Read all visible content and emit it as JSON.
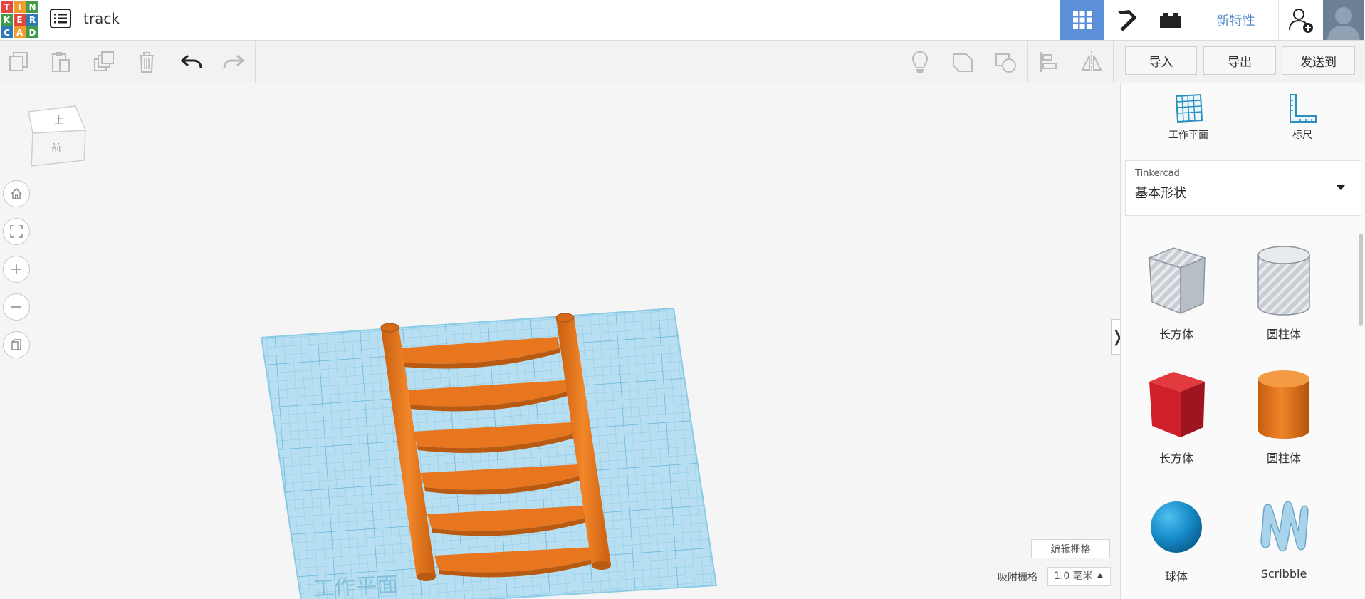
{
  "app": {
    "logo_letters": [
      "T",
      "I",
      "N",
      "K",
      "E",
      "R",
      "C",
      "A",
      "D"
    ],
    "logo_colors": [
      "#e2463c",
      "#f29a2e",
      "#3f9a49",
      "#3f9a49",
      "#e2463c",
      "#2e79b8",
      "#2e79b8",
      "#f29a2e",
      "#3f9a49"
    ],
    "project_title": "track"
  },
  "header": {
    "new_features": "新特性",
    "icons": [
      "3d-design-grid-icon",
      "minecraft-pickaxe-icon",
      "brick-icon",
      "add-user-icon",
      "avatar"
    ]
  },
  "toolbar": {
    "import_label": "导入",
    "export_label": "导出",
    "send_label": "发送到"
  },
  "viewcube": {
    "top": "上",
    "front": "前"
  },
  "grid": {
    "edit_label": "编辑栅格",
    "snap_label": "吸附栅格",
    "snap_value": "1.0 毫米",
    "workplane_watermark": "工作平面"
  },
  "panel": {
    "workplane_label": "工作平面",
    "ruler_label": "标尺",
    "library_provider": "Tinkercad",
    "library_name": "基本形状",
    "shapes": [
      {
        "label": "长方体",
        "icon": "box-hole-icon"
      },
      {
        "label": "圆柱体",
        "icon": "cylinder-hole-icon"
      },
      {
        "label": "长方体",
        "icon": "box-solid-icon"
      },
      {
        "label": "圆柱体",
        "icon": "cylinder-solid-icon"
      },
      {
        "label": "球体",
        "icon": "sphere-icon"
      },
      {
        "label": "Scribble",
        "icon": "scribble-icon"
      }
    ]
  },
  "colors": {
    "accent": "#5b8fd6",
    "rail": "#e8761e",
    "workplane": "#a9d8ee"
  }
}
